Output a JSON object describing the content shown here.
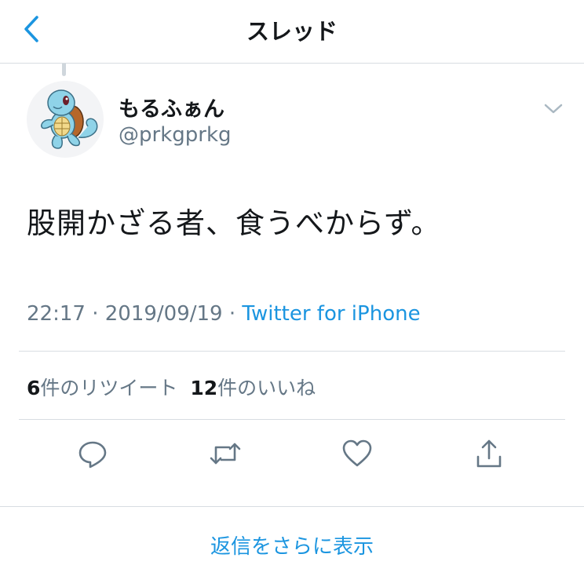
{
  "header": {
    "title": "スレッド"
  },
  "tweet": {
    "author_name": "もるふぁん",
    "author_handle": "@prkgprkg",
    "text": "股開かざる者、食うべからず。",
    "time": "22:17",
    "date": "2019/09/19",
    "separator": " · ",
    "source": "Twitter for iPhone"
  },
  "stats": {
    "retweets_count": "6",
    "retweets_label": "件のリツイート",
    "likes_count": "12",
    "likes_label": "件のいいね"
  },
  "footer": {
    "more_replies": "返信をさらに表示"
  },
  "icons": [
    "back-icon",
    "chevron-down-icon",
    "reply-icon",
    "retweet-icon",
    "like-icon",
    "share-icon"
  ],
  "colors": {
    "accent": "#1b95e0",
    "text": "#14171a",
    "muted": "#657786",
    "divider": "#d8dde2"
  }
}
